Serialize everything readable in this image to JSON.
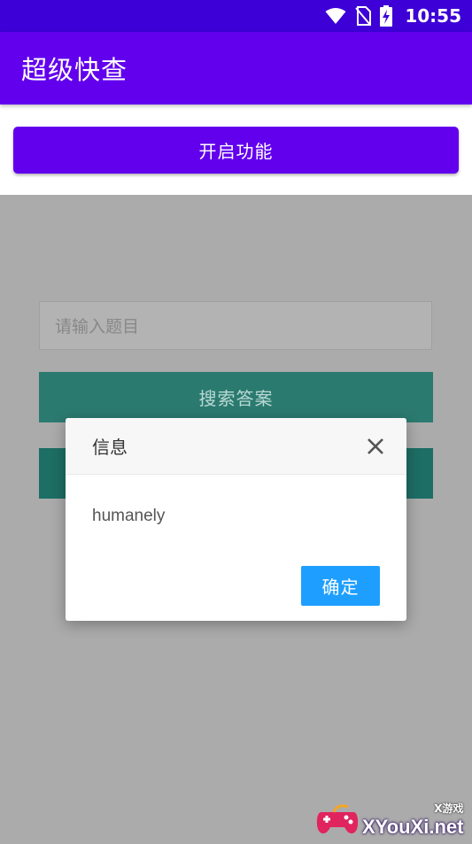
{
  "status_bar": {
    "time": "10:55",
    "icons": [
      "wifi-icon",
      "no-sim-icon",
      "battery-charging-icon"
    ]
  },
  "app_bar": {
    "title": "超级快查"
  },
  "top": {
    "enable_button_label": "开启功能"
  },
  "main": {
    "search_placeholder": "请输入题目",
    "search_button_label": "搜索答案"
  },
  "dialog": {
    "title": "信息",
    "message": "humanely",
    "confirm_label": "确定",
    "close_icon": "close-icon"
  },
  "watermark": {
    "small_text": "X游戏",
    "brand_text": "XYouXi.net"
  },
  "colors": {
    "status_bar": "#3d00d6",
    "app_bar": "#6200ee",
    "accent_button": "#6200ee",
    "teal_button": "#2b7a70",
    "confirm_button": "#1e9fff",
    "overlay": "#ababab"
  }
}
